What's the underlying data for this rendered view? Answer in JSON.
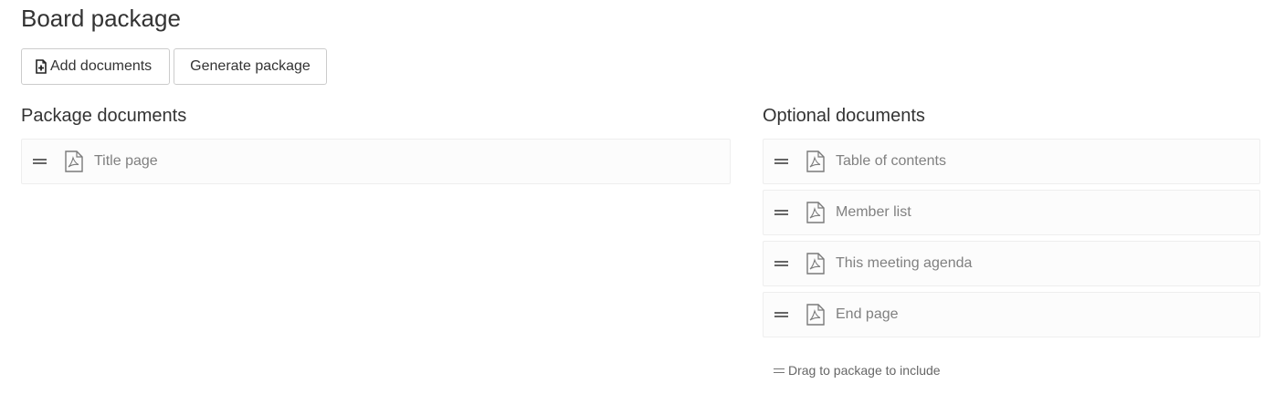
{
  "page": {
    "title": "Board package"
  },
  "toolbar": {
    "add_label": "Add documents",
    "add_icon": "file-plus-icon",
    "generate_label": "Generate package"
  },
  "package_section": {
    "title": "Package documents",
    "items": [
      {
        "label": "Title page",
        "icon": "pdf-file-icon"
      }
    ]
  },
  "optional_section": {
    "title": "Optional documents",
    "items": [
      {
        "label": "Table of contents",
        "icon": "pdf-file-icon"
      },
      {
        "label": "Member list",
        "icon": "pdf-file-icon"
      },
      {
        "label": "This meeting agenda",
        "icon": "pdf-file-icon"
      },
      {
        "label": "End page",
        "icon": "pdf-file-icon"
      }
    ]
  },
  "hint": {
    "text": "Drag to package to include"
  },
  "colors": {
    "item_background": "#fcfcfc",
    "item_border": "#eeeeee",
    "muted_text": "#808080"
  }
}
